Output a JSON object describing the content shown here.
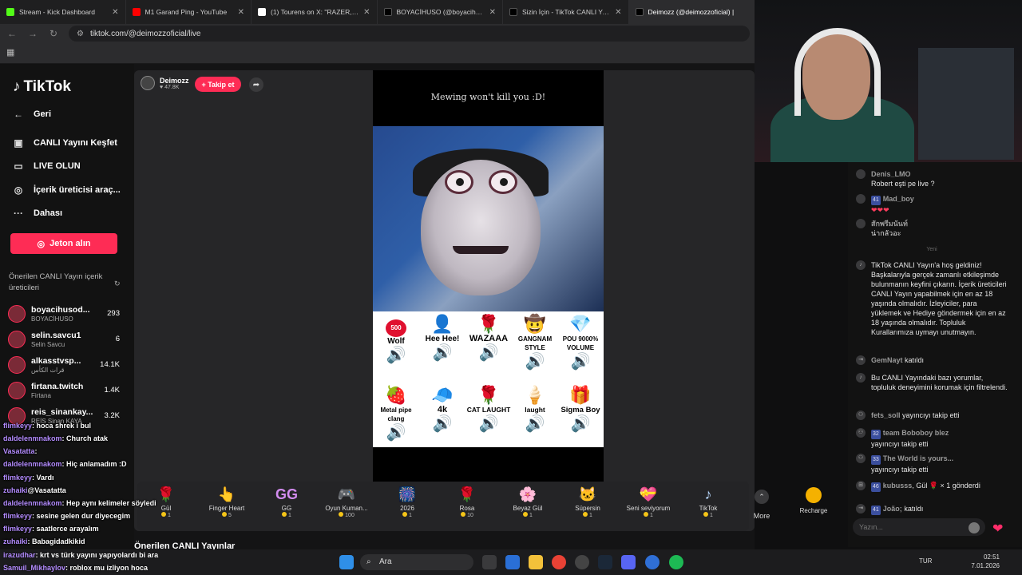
{
  "tabs": [
    {
      "title": "Stream - Kick Dashboard",
      "color": "#53fc18"
    },
    {
      "title": "M1 Garand Ping - YouTube",
      "color": "#ff0000"
    },
    {
      "title": "(1) Tourens on X: \"RAZER, oyun",
      "color": "#ffffff"
    },
    {
      "title": "BOYACİHUSO (@boyacihusod",
      "color": "#000000"
    },
    {
      "title": "Sizin İçin - TikTok CANLI Yayın",
      "color": "#000000"
    },
    {
      "title": "Deimozz (@deimozzoficial) |",
      "color": "#000000"
    }
  ],
  "url": "tiktok.com/@deimozzoficial/live",
  "sidebar": {
    "logo": "TikTok",
    "back": "Geri",
    "explore": "CANLI Yayını Keşfet",
    "go_live": "LIVE OLUN",
    "creator_tools": "İçerik üreticisi araç...",
    "more": "Dahası",
    "jeton": "Jeton alın",
    "recommended_title": "Önerilen CANLI Yayın içerik üreticileri",
    "recommended": [
      {
        "name": "boyacihusod...",
        "sub": "BOYACİHUSO",
        "count": "293"
      },
      {
        "name": "selin.savcu1",
        "sub": "Selin Savcu",
        "count": "6"
      },
      {
        "name": "alkasstvsp...",
        "sub": "قرات الكأس",
        "count": "14.1K"
      },
      {
        "name": "firtana.twitch",
        "sub": "Firtana",
        "count": "1.4K"
      },
      {
        "name": "reis_sinankay...",
        "sub": "REİS Sinan KAYA",
        "count": "3.2K"
      }
    ]
  },
  "overlay_chat": [
    {
      "user": "flimkeyy",
      "msg": ": hoca shrek i bul"
    },
    {
      "user": "daldelenmnakom",
      "msg": ": Church atak"
    },
    {
      "user": "Vasatatta",
      "msg": ":"
    },
    {
      "user": "daldelenmnakom",
      "msg": ": Hiç anlamadım :D"
    },
    {
      "user": "flimkeyy",
      "msg": ": Vardı"
    },
    {
      "user": "zuhaiki",
      "msg": "@Vasatatta"
    },
    {
      "user": "daldelenmnakom",
      "msg": ": Hep aynı kelimeler söyledi"
    },
    {
      "user": "flimkeyy",
      "msg": ": sesine gelen dur diyecegim"
    },
    {
      "user": "flimkeyy",
      "msg": ": saatlerce arayalım"
    },
    {
      "user": "zuhaiki",
      "msg": ": Babagidadkikid"
    },
    {
      "user": "irazudhar",
      "msg": ": krt vs türk yayını yapıyolardı bi ara"
    },
    {
      "user": "Samuil_Mikhaylov",
      "msg": ": roblox mu izliyon hoca"
    }
  ],
  "host": {
    "name": "Deimozz",
    "viewers": "47.8K",
    "follow": "+ Takip et"
  },
  "video": {
    "caption": "Mewing won't kill you :D!",
    "gifts_row1": [
      {
        "icon": "500",
        "label": "Wolf"
      },
      {
        "icon": "👤",
        "label": "Hee Hee!"
      },
      {
        "icon": "🌹",
        "label": "WAZAAA"
      },
      {
        "icon": "🤠",
        "label": "GANGNAM STYLE"
      },
      {
        "icon": "💎",
        "label": "POU 9000% VOLUME"
      }
    ],
    "gifts_row2": [
      {
        "icon": "🍓",
        "label": "Metal pipe clang"
      },
      {
        "icon": "🧢",
        "label": "4k"
      },
      {
        "icon": "🌹",
        "label": "CAT LAUGHT"
      },
      {
        "icon": "🍦",
        "label": "laught"
      },
      {
        "icon": "🎁",
        "label": "Sigma Boy"
      }
    ]
  },
  "giftbar": [
    {
      "icon": "🌹",
      "name": "Gül",
      "price": "1"
    },
    {
      "icon": "👆",
      "name": "Finger Heart",
      "price": "5"
    },
    {
      "icon": "GG",
      "name": "GG",
      "price": "1"
    },
    {
      "icon": "🎮",
      "name": "Oyun Kuman...",
      "price": "100"
    },
    {
      "icon": "🎆",
      "name": "2026",
      "price": "1"
    },
    {
      "icon": "🌹",
      "name": "Rosa",
      "price": "10"
    },
    {
      "icon": "🌸",
      "name": "Beyaz Gül",
      "price": "1"
    },
    {
      "icon": "🐱",
      "name": "Süpersin",
      "price": "1"
    },
    {
      "icon": "💝",
      "name": "Seni seviyorum",
      "price": "1"
    },
    {
      "icon": "♪",
      "name": "TikTok",
      "price": "1"
    }
  ],
  "more_label": "More",
  "recharge_label": "Recharge",
  "suggest_title": "Önerilen CANLI Yayınlar",
  "chat": [
    {
      "user": "Denis_LMO",
      "text": "Robert eşti pe live ?"
    },
    {
      "user": "Mad_boy",
      "badge": "41",
      "text": "❤❤❤"
    },
    {
      "user": "สักพรีมนันท์",
      "text": "น่ากลัวอะ"
    },
    {
      "system": "Yeni"
    },
    {
      "text": "TikTok CANLI Yayın'a hoş geldiniz! Başkalarıyla gerçek zamanlı etkileşimde bulunmanın keyfini çıkarın. İçerik üreticileri CANLI Yayın yapabilmek için en az 18 yaşında olmalıdır. İzleyiciler, para yüklemek ve Hediye göndermek için en az 18 yaşında olmalıdır. Topluluk Kurallarımıza uymayı unutmayın."
    },
    {
      "user": "GemNayt",
      "text": "katıldı"
    },
    {
      "text": "Bu CANLI Yayındaki bazı yorumlar, topluluk deneyimini korumak için filtrelendi."
    },
    {
      "user": "fets_soll",
      "text": "yayıncıyı takip etti"
    },
    {
      "user": "team Boboboy blez",
      "badge": "32",
      "text": "yayıncıyı takip etti"
    },
    {
      "user": "The World is yours...",
      "badge": "33",
      "text": "yayıncıyı takip etti"
    },
    {
      "user": "kubusss",
      "badge": "46",
      "text": ", Gül 🌹 × 1 gönderdi"
    },
    {
      "user": "João;",
      "badge": "41",
      "text": "katıldı"
    }
  ],
  "chat_placeholder": "Yazın...",
  "taskbar": {
    "search": "Ara",
    "lang": "TUR",
    "time": "02:51",
    "date": "7.01.2026"
  }
}
